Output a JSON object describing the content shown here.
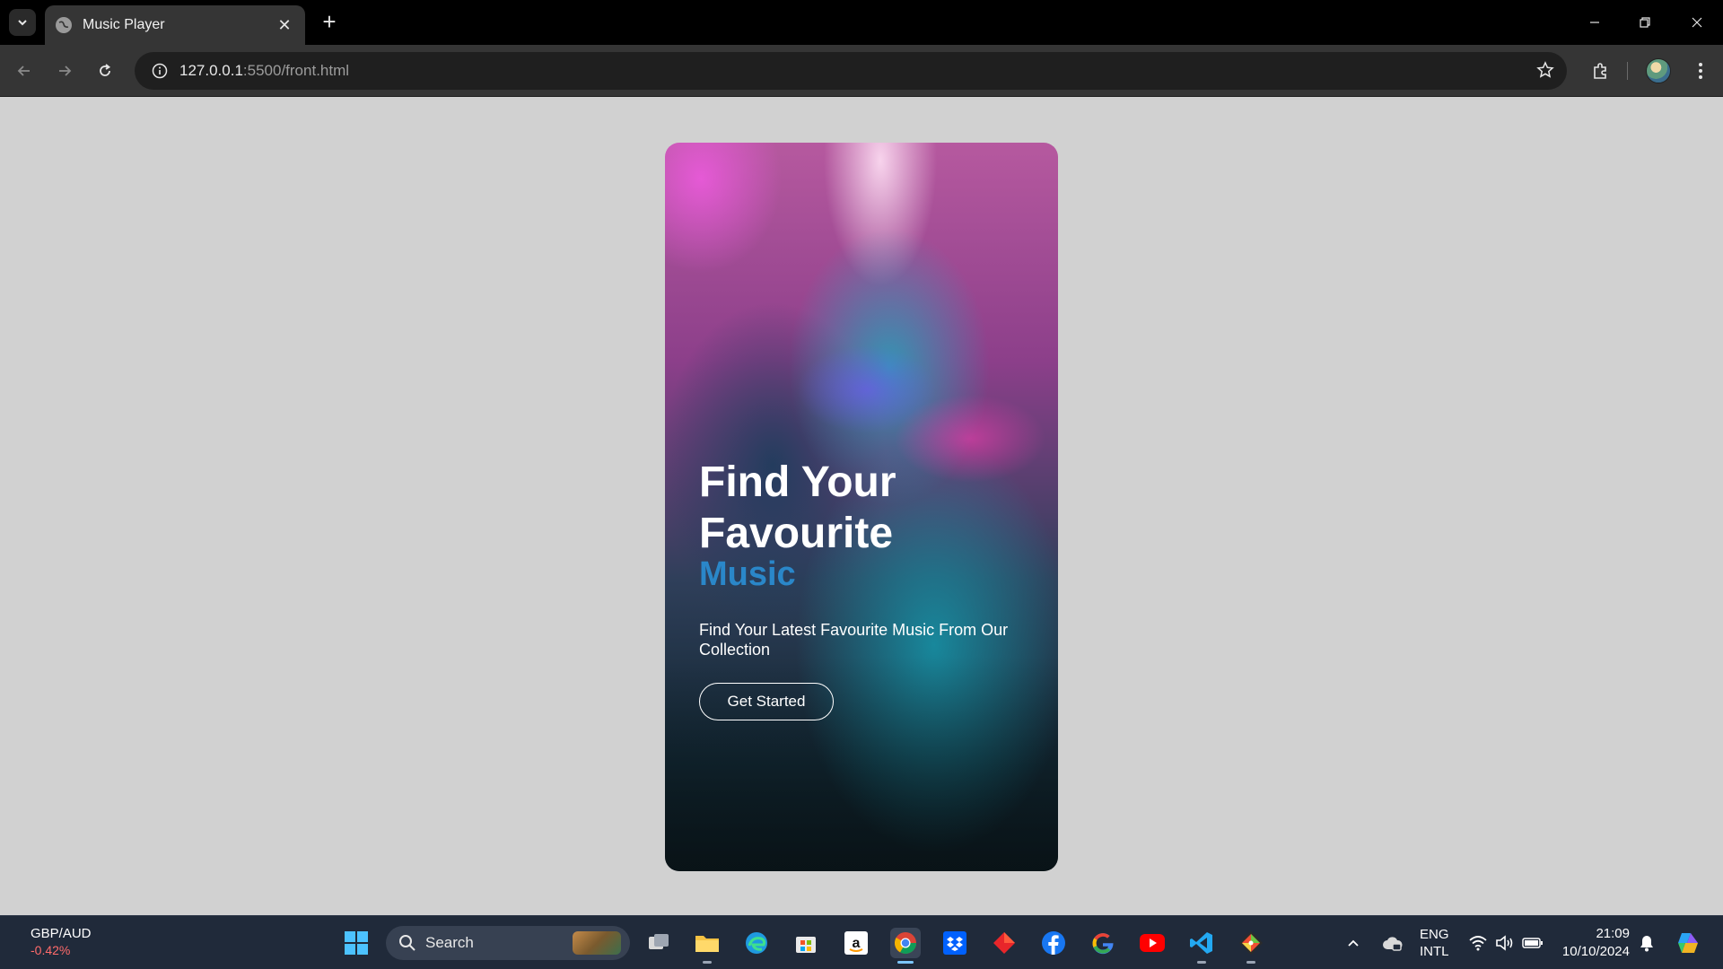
{
  "browser": {
    "tab_title": "Music Player",
    "url_host": "127.0.0.1",
    "url_rest": ":5500/front.html"
  },
  "card": {
    "title_line1": "Find Your",
    "title_line2": "Favourite",
    "accent": "Music",
    "subtitle": "Find Your Latest Favourite Music From Our Collection",
    "button_label": "Get Started"
  },
  "colors": {
    "page_background": "#d1d1d1",
    "accent_text": "#2a87c9",
    "taskbar": "#202a3a",
    "change_negative": "#ff6b6b"
  },
  "taskbar": {
    "widget_pair": "GBP/AUD",
    "widget_change": "-0.42%",
    "search_label": "Search",
    "apps": [
      "windows-start-icon",
      "task-view-icon",
      "file-explorer-icon",
      "edge-icon",
      "microsoft-store-icon",
      "amazon-icon",
      "chrome-icon",
      "dropbox-icon",
      "red-diamond-app-icon",
      "facebook-icon",
      "google-icon",
      "youtube-icon",
      "vscode-icon",
      "git-icon"
    ],
    "lang_top": "ENG",
    "lang_bottom": "INTL",
    "time": "21:09",
    "date": "10/10/2024"
  }
}
